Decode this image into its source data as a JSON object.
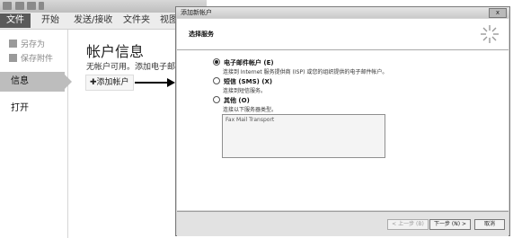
{
  "outlook": {
    "ribbon_tabs": [
      "文件",
      "开始",
      "发送/接收",
      "文件夹",
      "视图"
    ],
    "backstage": {
      "save_as": "另存为",
      "save_attachments": "保存附件",
      "info": "信息",
      "open": "打开"
    },
    "info_panel": {
      "title": "帐户信息",
      "subtitle": "无帐户可用。添加电子邮件",
      "add_account": "添加帐户"
    }
  },
  "dialog": {
    "title": "添加新帐户",
    "close_label": "x",
    "heading": "选择服务",
    "options": [
      {
        "label": "电子邮件帐户 (E)",
        "description": "连接到 Internet 服务提供商 (ISP) 或您的组织提供的电子邮件帐户。",
        "checked": true
      },
      {
        "label": "短信 (SMS) (X)",
        "description": "连接到短信服务。",
        "checked": false
      },
      {
        "label": "其他 (O)",
        "description": "连接以下服务器类型。",
        "checked": false
      }
    ],
    "transport_list": [
      "Fax Mail Transport"
    ],
    "buttons": {
      "back": "< 上一步 (B)",
      "next": "下一步 (N) >",
      "cancel": "取消"
    }
  }
}
